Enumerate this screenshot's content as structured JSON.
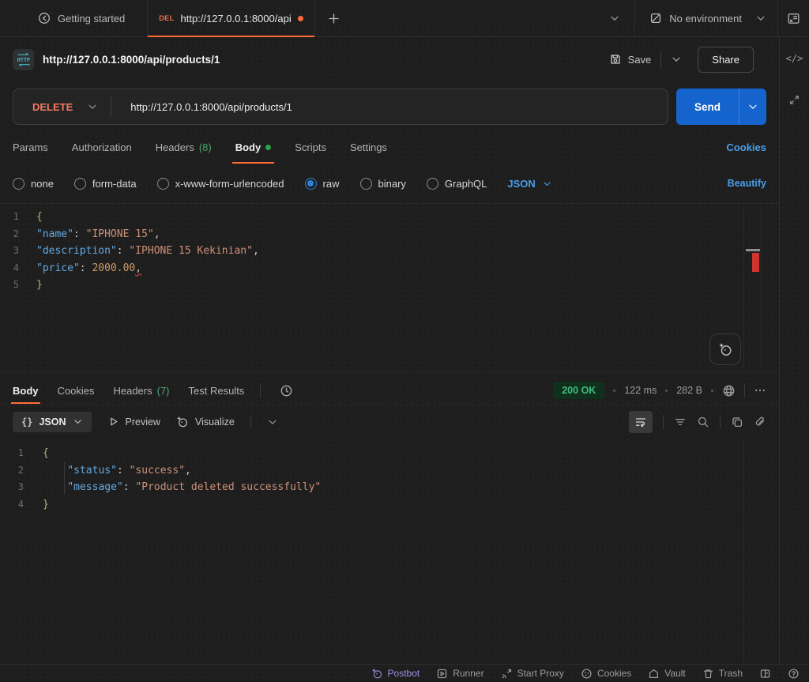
{
  "topbar": {
    "getting_started": "Getting started",
    "active_tab": {
      "method": "DEL",
      "title": "http://127.0.0.1:8000/api"
    },
    "environment": "No environment"
  },
  "rail": {
    "code_glyph": "</>"
  },
  "request": {
    "title": "http://127.0.0.1:8000/api/products/1",
    "save": "Save",
    "share": "Share",
    "method": "DELETE",
    "url": "http://127.0.0.1:8000/api/products/1",
    "send": "Send",
    "tabs": {
      "params": "Params",
      "authorization": "Authorization",
      "headers": "Headers",
      "headers_count": "(8)",
      "body": "Body",
      "scripts": "Scripts",
      "settings": "Settings"
    },
    "cookies_link": "Cookies",
    "modes": [
      "none",
      "form-data",
      "x-www-form-urlencoded",
      "raw",
      "binary",
      "GraphQL"
    ],
    "language": "JSON",
    "beautify": "Beautify"
  },
  "request_editor": {
    "lines": [
      {
        "n": "1",
        "tokens": [
          [
            "brace",
            "{"
          ]
        ]
      },
      {
        "n": "2",
        "tokens": [
          [
            "key",
            "\"name\""
          ],
          [
            "plain",
            ": "
          ],
          [
            "string",
            "\"IPHONE 15\""
          ],
          [
            "plain",
            ","
          ]
        ]
      },
      {
        "n": "3",
        "tokens": [
          [
            "key",
            "\"description\""
          ],
          [
            "plain",
            ": "
          ],
          [
            "string",
            "\"IPHONE 15 Kekinian\""
          ],
          [
            "plain",
            ","
          ]
        ]
      },
      {
        "n": "4",
        "tokens": [
          [
            "key",
            "\"price\""
          ],
          [
            "plain",
            ": "
          ],
          [
            "number",
            "2000.00"
          ],
          [
            "error",
            ","
          ]
        ]
      },
      {
        "n": "5",
        "tokens": [
          [
            "brace",
            "}"
          ]
        ]
      }
    ]
  },
  "response": {
    "tabs": {
      "body": "Body",
      "cookies": "Cookies",
      "headers": "Headers",
      "headers_count": "(7)",
      "test_results": "Test Results"
    },
    "status": "200 OK",
    "time": "122 ms",
    "size": "282 B",
    "braces_glyph": "{}",
    "language": "JSON",
    "preview": "Preview",
    "visualize": "Visualize"
  },
  "response_editor": {
    "lines": [
      {
        "n": "1",
        "tokens": [
          [
            "brace",
            "{"
          ]
        ]
      },
      {
        "n": "2",
        "tokens": [
          [
            "plain",
            "    "
          ],
          [
            "key",
            "\"status\""
          ],
          [
            "plain",
            ": "
          ],
          [
            "string",
            "\"success\""
          ],
          [
            "plain",
            ","
          ]
        ]
      },
      {
        "n": "3",
        "tokens": [
          [
            "plain",
            "    "
          ],
          [
            "key",
            "\"message\""
          ],
          [
            "plain",
            ": "
          ],
          [
            "string",
            "\"Product deleted successfully\""
          ]
        ]
      },
      {
        "n": "4",
        "tokens": [
          [
            "brace",
            "}"
          ]
        ]
      }
    ]
  },
  "statusbar": {
    "postbot": "Postbot",
    "runner": "Runner",
    "start_proxy": "Start Proxy",
    "cookies": "Cookies",
    "vault": "Vault",
    "trash": "Trash"
  },
  "colors": {
    "accent_orange": "#ff6c37",
    "method_delete": "#f47862",
    "send_blue": "#1564cd",
    "link_blue": "#4a9ee8",
    "success_green": "#3fbd7d",
    "error_red": "#cf352e"
  }
}
